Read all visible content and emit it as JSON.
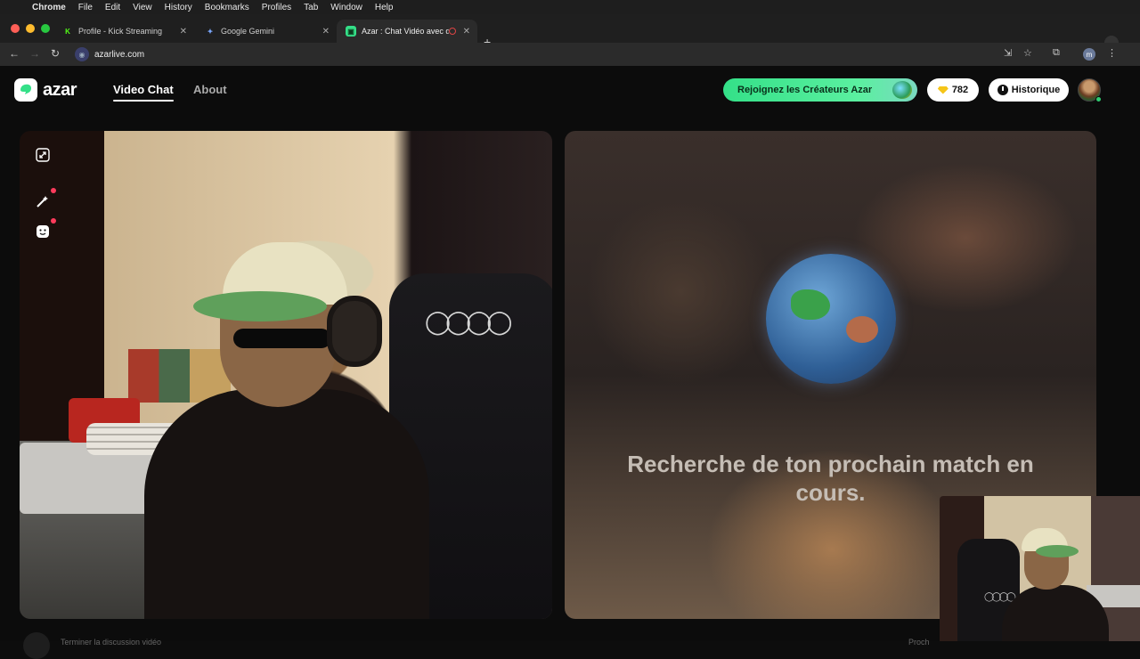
{
  "menubar": {
    "app": "Chrome",
    "items": [
      "File",
      "Edit",
      "View",
      "History",
      "Bookmarks",
      "Profiles",
      "Tab",
      "Window",
      "Help"
    ]
  },
  "tabs": [
    {
      "label": "Profile - Kick Streaming",
      "favicon": "K",
      "favicon_color": "#53fc18"
    },
    {
      "label": "Google Gemini",
      "favicon": "✦",
      "favicon_color": "#7aa7ff"
    },
    {
      "label": "Azar : Chat Vidéo avec de",
      "favicon": "▣",
      "favicon_color": "#34e088"
    }
  ],
  "toolbar": {
    "url": "azarlive.com",
    "profile_initial": "m"
  },
  "header": {
    "brand": "azar",
    "nav": [
      "Video Chat",
      "About"
    ],
    "creators_button": "Rejoignez les Créateurs Azar",
    "gems_count": "782",
    "history_button": "Historique"
  },
  "match": {
    "searching_text": "Recherche de ton prochain match en cours."
  },
  "footer": {
    "left_text": "Terminer la discussion vidéo",
    "right_text": "Proch"
  },
  "colors": {
    "accent": "#34e088",
    "notification_dot": "#ff3b5c",
    "online_dot": "#2ecc71"
  },
  "icons": {
    "minimize": "exit-fullscreen-icon",
    "effects": "magic-wand-icon",
    "filters": "smiley-icon"
  }
}
